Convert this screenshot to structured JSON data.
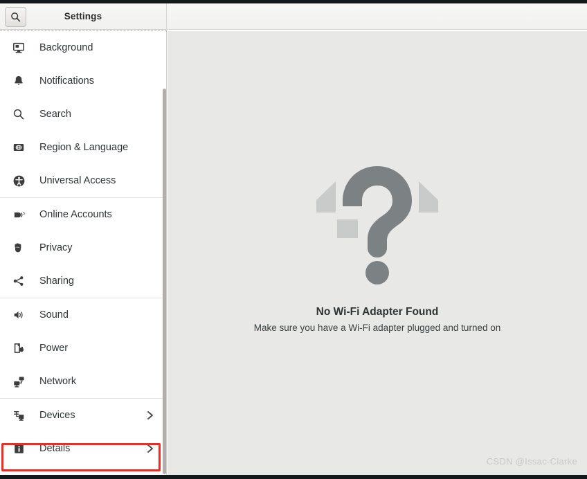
{
  "window": {
    "title": "Settings"
  },
  "header": {
    "search_icon": "search-icon"
  },
  "sidebar": {
    "groups": [
      {
        "items": [
          {
            "label": "Background",
            "icon": "display-icon",
            "chevron": false
          },
          {
            "label": "Notifications",
            "icon": "bell-icon",
            "chevron": false
          },
          {
            "label": "Search",
            "icon": "magnifier-icon",
            "chevron": false
          },
          {
            "label": "Region & Language",
            "icon": "flag-icon",
            "chevron": false
          },
          {
            "label": "Universal Access",
            "icon": "accessibility-icon",
            "chevron": false
          }
        ]
      },
      {
        "items": [
          {
            "label": "Online Accounts",
            "icon": "online-accounts-icon",
            "chevron": false
          },
          {
            "label": "Privacy",
            "icon": "hand-icon",
            "chevron": false
          },
          {
            "label": "Sharing",
            "icon": "share-icon",
            "chevron": false
          }
        ]
      },
      {
        "items": [
          {
            "label": "Sound",
            "icon": "speaker-icon",
            "chevron": false
          },
          {
            "label": "Power",
            "icon": "battery-plug-icon",
            "chevron": false
          },
          {
            "label": "Network",
            "icon": "network-icon",
            "chevron": false
          }
        ]
      },
      {
        "items": [
          {
            "label": "Devices",
            "icon": "devices-icon",
            "chevron": true
          },
          {
            "label": "Details",
            "icon": "info-icon",
            "chevron": true,
            "highlighted": true
          }
        ]
      }
    ]
  },
  "main": {
    "empty_state": {
      "icon": "question-mark-wifi-icon",
      "title": "No Wi-Fi Adapter Found",
      "subtitle": "Make sure you have a Wi-Fi adapter plugged and turned on"
    }
  },
  "watermark": {
    "text": "CSDN @Issac-Clarke"
  },
  "colors": {
    "highlight": "#f22a22",
    "sidebar_bg": "#ffffff",
    "content_bg": "#e8e8e6",
    "icon_gray": "#7c8184",
    "icon_gray_light": "#c9cbcb"
  }
}
